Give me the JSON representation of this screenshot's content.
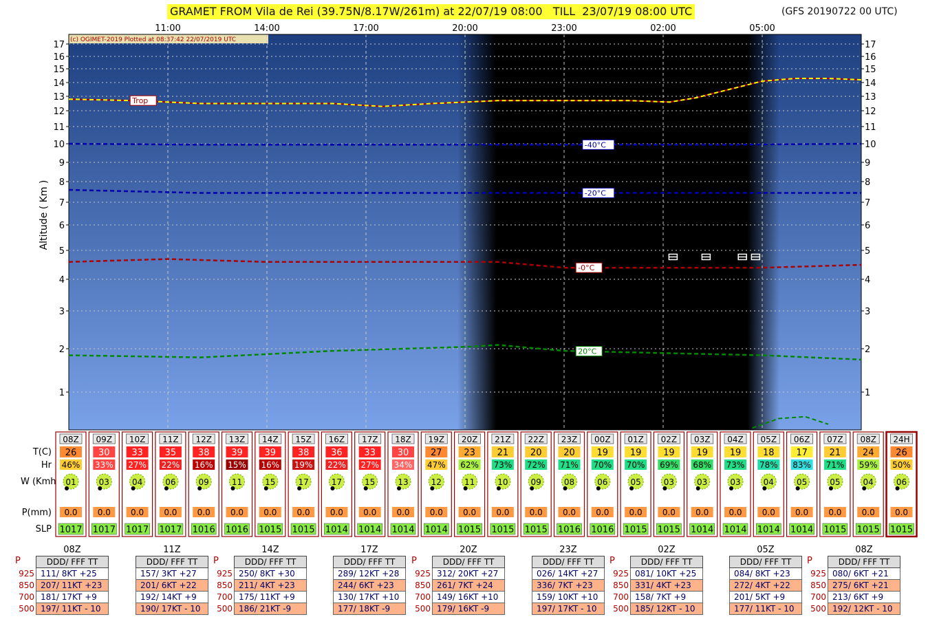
{
  "title": "GRAMET FROM Vila de Rei (39.75N/8.17W/261m) at 22/07/19 08:00   TILL  23/07/19 08:00 UTC",
  "model": "(GFS 20190722 00 UTC)",
  "credit": "(c) OGIMET-2019 Plotted at 08:37:42 22/07/2019 UTC",
  "colors": {
    "sky_top": "#1d3f80",
    "sky_bottom": "#7aa2e8",
    "night": "#000000",
    "trop": "#ffff00",
    "iso_neg40": "#0000aa",
    "iso_neg20": "#0000aa",
    "iso_0": "#aa0000",
    "iso_20": "#008800",
    "temp_hot": "#ff2222",
    "temp_warm": "#ff8833",
    "temp_mild": "#ffcc33",
    "hr_green": "#22dd88",
    "box_border": "#990000"
  },
  "chart_data": {
    "type": "line",
    "ylabel": "Altitude ( Km )",
    "y_ticks": [
      1,
      2,
      3,
      4,
      5,
      6,
      7,
      8,
      9,
      10,
      11,
      12,
      13,
      14,
      15,
      16,
      17
    ],
    "x_hours": [
      0,
      24
    ],
    "top_time_labels": [
      {
        "h": 3,
        "label": "11:00"
      },
      {
        "h": 6,
        "label": "14:00"
      },
      {
        "h": 9,
        "label": "17:00"
      },
      {
        "h": 12,
        "label": "20:00"
      },
      {
        "h": 15,
        "label": "23:00"
      },
      {
        "h": 18,
        "label": "02:00"
      },
      {
        "h": 21,
        "label": "05:00"
      }
    ],
    "night": {
      "start": 12.4,
      "end": 20.9
    },
    "series": [
      {
        "name": "Trop",
        "label": "Trop",
        "label_h": 1.9,
        "points": [
          [
            0,
            12.8
          ],
          [
            2,
            12.7
          ],
          [
            4,
            12.5
          ],
          [
            6,
            12.5
          ],
          [
            8,
            12.5
          ],
          [
            9.5,
            12.3
          ],
          [
            11,
            12.5
          ],
          [
            13,
            12.7
          ],
          [
            15,
            12.7
          ],
          [
            17,
            12.7
          ],
          [
            18.2,
            12.6
          ],
          [
            19,
            12.9
          ],
          [
            20,
            13.5
          ],
          [
            21,
            14.1
          ],
          [
            22,
            14.3
          ],
          [
            23,
            14.3
          ],
          [
            24,
            14.2
          ]
        ]
      },
      {
        "name": "-40°C",
        "label": "-40°C",
        "label_h": 15.6,
        "points": [
          [
            0,
            10.0
          ],
          [
            4,
            9.95
          ],
          [
            8,
            9.95
          ],
          [
            12,
            9.95
          ],
          [
            16,
            9.95
          ],
          [
            20,
            9.95
          ],
          [
            24,
            10.0
          ]
        ]
      },
      {
        "name": "-20°C",
        "label": "-20°C",
        "label_h": 15.6,
        "points": [
          [
            0,
            7.6
          ],
          [
            4,
            7.45
          ],
          [
            8,
            7.45
          ],
          [
            12,
            7.45
          ],
          [
            16,
            7.45
          ],
          [
            20,
            7.45
          ],
          [
            24,
            7.45
          ]
        ]
      },
      {
        "name": "-0°C",
        "label": "-0°C",
        "label_h": 15.4,
        "points": [
          [
            0,
            4.6
          ],
          [
            3,
            4.7
          ],
          [
            6,
            4.6
          ],
          [
            9,
            4.6
          ],
          [
            12,
            4.6
          ],
          [
            13,
            4.6
          ],
          [
            15,
            4.4
          ],
          [
            18,
            4.4
          ],
          [
            21,
            4.4
          ],
          [
            24,
            4.5
          ]
        ]
      },
      {
        "name": "20°C",
        "label": "20°C",
        "label_h": 15.4,
        "points": [
          [
            0,
            1.85
          ],
          [
            4,
            1.8
          ],
          [
            8,
            1.95
          ],
          [
            12,
            2.05
          ],
          [
            13,
            2.1
          ],
          [
            15,
            1.95
          ],
          [
            18,
            1.9
          ],
          [
            21,
            1.85
          ],
          [
            24,
            1.75
          ]
        ]
      }
    ],
    "night_curve": [
      [
        20.7,
        0.05
      ],
      [
        21.5,
        0.3
      ],
      [
        22.3,
        0.35
      ],
      [
        23,
        0.15
      ]
    ],
    "icing_marks": [
      18.3,
      19.3,
      20.4,
      20.8
    ],
    "columns": [
      {
        "time": "08Z",
        "t": "26",
        "hr": "46%",
        "w": "01",
        "p": "0.0",
        "slp": "1017",
        "tc": "#ff8833",
        "hc": "#ffcc33"
      },
      {
        "time": "09Z",
        "t": "30",
        "hr": "33%",
        "w": "03",
        "p": "0.0",
        "slp": "1017",
        "tc": "#ff4444",
        "hc": "#ff4444"
      },
      {
        "time": "10Z",
        "t": "33",
        "hr": "27%",
        "w": "04",
        "p": "0.0",
        "slp": "1017",
        "tc": "#ff2222",
        "hc": "#ff2222"
      },
      {
        "time": "11Z",
        "t": "35",
        "hr": "22%",
        "w": "06",
        "p": "0.0",
        "slp": "1017",
        "tc": "#ff2222",
        "hc": "#ee2222"
      },
      {
        "time": "12Z",
        "t": "38",
        "hr": "16%",
        "w": "09",
        "p": "0.0",
        "slp": "1016",
        "tc": "#ff2222",
        "hc": "#bb0000"
      },
      {
        "time": "13Z",
        "t": "39",
        "hr": "15%",
        "w": "11",
        "p": "0.0",
        "slp": "1016",
        "tc": "#ff2222",
        "hc": "#990000"
      },
      {
        "time": "14Z",
        "t": "39",
        "hr": "16%",
        "w": "15",
        "p": "0.0",
        "slp": "1015",
        "tc": "#ff2222",
        "hc": "#bb0000"
      },
      {
        "time": "15Z",
        "t": "38",
        "hr": "19%",
        "w": "17",
        "p": "0.0",
        "slp": "1015",
        "tc": "#ff2222",
        "hc": "#cc1111"
      },
      {
        "time": "16Z",
        "t": "36",
        "hr": "22%",
        "w": "17",
        "p": "0.0",
        "slp": "1014",
        "tc": "#ff2222",
        "hc": "#ee2222"
      },
      {
        "time": "17Z",
        "t": "33",
        "hr": "27%",
        "w": "15",
        "p": "0.0",
        "slp": "1014",
        "tc": "#ff2222",
        "hc": "#ff2222"
      },
      {
        "time": "18Z",
        "t": "30",
        "hr": "34%",
        "w": "13",
        "p": "0.0",
        "slp": "1014",
        "tc": "#ff4444",
        "hc": "#ff6666"
      },
      {
        "time": "19Z",
        "t": "27",
        "hr": "47%",
        "w": "12",
        "p": "0.0",
        "slp": "1014",
        "tc": "#ff8833",
        "hc": "#ffcc33"
      },
      {
        "time": "20Z",
        "t": "23",
        "hr": "62%",
        "w": "11",
        "p": "0.0",
        "slp": "1015",
        "tc": "#ffaa33",
        "hc": "#aaee44"
      },
      {
        "time": "21Z",
        "t": "21",
        "hr": "73%",
        "w": "10",
        "p": "0.0",
        "slp": "1015",
        "tc": "#ffcc33",
        "hc": "#22dd88"
      },
      {
        "time": "22Z",
        "t": "20",
        "hr": "72%",
        "w": "09",
        "p": "0.0",
        "slp": "1015",
        "tc": "#ffcc33",
        "hc": "#22dd88"
      },
      {
        "time": "23Z",
        "t": "20",
        "hr": "71%",
        "w": "08",
        "p": "0.0",
        "slp": "1016",
        "tc": "#ffcc33",
        "hc": "#22dd88"
      },
      {
        "time": "00Z",
        "t": "19",
        "hr": "70%",
        "w": "06",
        "p": "0.0",
        "slp": "1016",
        "tc": "#ffdd33",
        "hc": "#22dd88"
      },
      {
        "time": "01Z",
        "t": "19",
        "hr": "70%",
        "w": "05",
        "p": "0.0",
        "slp": "1015",
        "tc": "#ffdd33",
        "hc": "#22dd88"
      },
      {
        "time": "02Z",
        "t": "19",
        "hr": "69%",
        "w": "03",
        "p": "0.0",
        "slp": "1015",
        "tc": "#ffdd33",
        "hc": "#33dd66"
      },
      {
        "time": "03Z",
        "t": "19",
        "hr": "68%",
        "w": "03",
        "p": "0.0",
        "slp": "1014",
        "tc": "#ffdd33",
        "hc": "#33dd66"
      },
      {
        "time": "04Z",
        "t": "19",
        "hr": "73%",
        "w": "03",
        "p": "0.0",
        "slp": "1014",
        "tc": "#ffdd33",
        "hc": "#22dd88"
      },
      {
        "time": "05Z",
        "t": "18",
        "hr": "78%",
        "w": "04",
        "p": "0.0",
        "slp": "1014",
        "tc": "#ffdd33",
        "hc": "#22ddaa"
      },
      {
        "time": "06Z",
        "t": "17",
        "hr": "83%",
        "w": "05",
        "p": "0.0",
        "slp": "1014",
        "tc": "#ffee33",
        "hc": "#33dddd"
      },
      {
        "time": "07Z",
        "t": "21",
        "hr": "71%",
        "w": "05",
        "p": "0.0",
        "slp": "1015",
        "tc": "#ffcc33",
        "hc": "#22dd88"
      },
      {
        "time": "08Z",
        "t": "24",
        "hr": "59%",
        "w": "04",
        "p": "0.0",
        "slp": "1015",
        "tc": "#ffaa33",
        "hc": "#aaee44"
      },
      {
        "time": "24H",
        "t": "26",
        "hr": "50%",
        "w": "06",
        "p": "0.0",
        "slp": "1015",
        "tc": "#ff8833",
        "hc": "#ffcc33"
      }
    ],
    "row_labels": {
      "t": "T(C)",
      "hr": "Hr",
      "w": "W (Kmh)",
      "p": "P(mm)",
      "slp": "SLP"
    },
    "upper_tables": [
      {
        "time": "08Z",
        "with_p": true,
        "header": "DDD/ FFF TT",
        "rows": [
          "111/ 8KT +25",
          "207/ 11KT +23",
          "181/ 17KT +9",
          "197/ 11KT - 10"
        ]
      },
      {
        "time": "11Z",
        "with_p": false,
        "header": "DDD/ FFF TT",
        "rows": [
          "157/ 3KT +27",
          "201/ 6KT +22",
          "192/ 14KT +9",
          "190/ 17KT - 10"
        ]
      },
      {
        "time": "14Z",
        "with_p": true,
        "header": "DDD/ FFF TT",
        "rows": [
          "250/ 8KT +30",
          "211/ 4KT +23",
          "175/ 11KT +9",
          "186/ 21KT -9"
        ]
      },
      {
        "time": "17Z",
        "with_p": false,
        "header": "DDD/ FFF TT",
        "rows": [
          "289/ 12KT +28",
          "244/ 6KT +23",
          "130/ 17KT +10",
          "177/ 18KT -9"
        ]
      },
      {
        "time": "20Z",
        "with_p": true,
        "header": "DDD/ FFF TT",
        "rows": [
          "312/ 20KT +27",
          "261/ 7KT +24",
          "149/ 16KT +10",
          "179/ 16KT -9"
        ]
      },
      {
        "time": "23Z",
        "with_p": false,
        "header": "DDD/ FFF TT",
        "rows": [
          "026/ 14KT +27",
          "336/ 7KT +23",
          "159/ 10KT +10",
          "197/ 17KT - 10"
        ]
      },
      {
        "time": "02Z",
        "with_p": true,
        "header": "DDD/ FFF TT",
        "rows": [
          "081/ 10KT +25",
          "331/ 4KT +23",
          "158/ 7KT +9",
          "185/ 12KT - 10"
        ]
      },
      {
        "time": "05Z",
        "with_p": false,
        "header": "DDD/ FFF TT",
        "rows": [
          "084/ 8KT +23",
          "272/ 4KT +22",
          "201/ 5KT +9",
          "177/ 11KT - 10"
        ]
      },
      {
        "time": "08Z",
        "with_p": true,
        "header": "DDD/ FFF TT",
        "rows": [
          "080/ 6KT +21",
          "275/ 6KT +21",
          "213/ 6KT +9",
          "192/ 12KT - 10"
        ]
      }
    ],
    "pressure_levels": [
      "925",
      "850",
      "700",
      "500"
    ],
    "p_label": "P"
  }
}
